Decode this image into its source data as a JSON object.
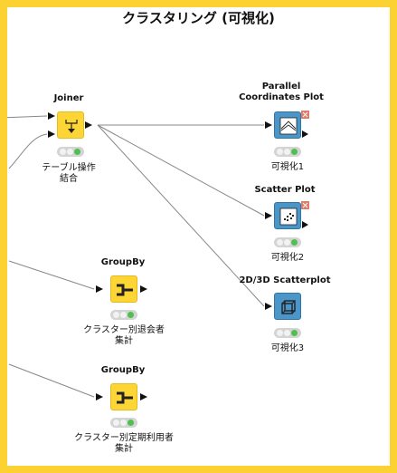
{
  "workflow": {
    "title": "クラスタリング (可視化)"
  },
  "nodes": {
    "joiner": {
      "label": "Joiner",
      "caption": [
        "テーブル操作",
        "結合"
      ]
    },
    "parallel": {
      "label": [
        "Parallel",
        "Coordinates Plot"
      ],
      "caption": [
        "可視化1"
      ]
    },
    "scatter": {
      "label": "Scatter Plot",
      "caption": [
        "可視化2"
      ]
    },
    "scatter3d": {
      "label": "2D/3D Scatterplot",
      "caption": [
        "可視化3"
      ]
    },
    "groupby1": {
      "label": "GroupBy",
      "caption": [
        "クラスター別退会者",
        "集計"
      ]
    },
    "groupby2": {
      "label": "GroupBy",
      "caption": [
        "クラスター別定期利用者",
        "集計"
      ]
    }
  },
  "colors": {
    "border": "#fcd233",
    "manipulator_node": "#fdd535",
    "view_node": "#4a96c8",
    "status_ok": "#4ec04e",
    "warning_marker": "#e07b6a",
    "connection": "#888888"
  },
  "icons": {
    "joiner": "join-arrows-icon",
    "parallel": "parallel-coordinates-icon",
    "scatter": "scatter-dots-icon",
    "scatter3d": "cube-icon",
    "groupby": "groupby-icon"
  }
}
